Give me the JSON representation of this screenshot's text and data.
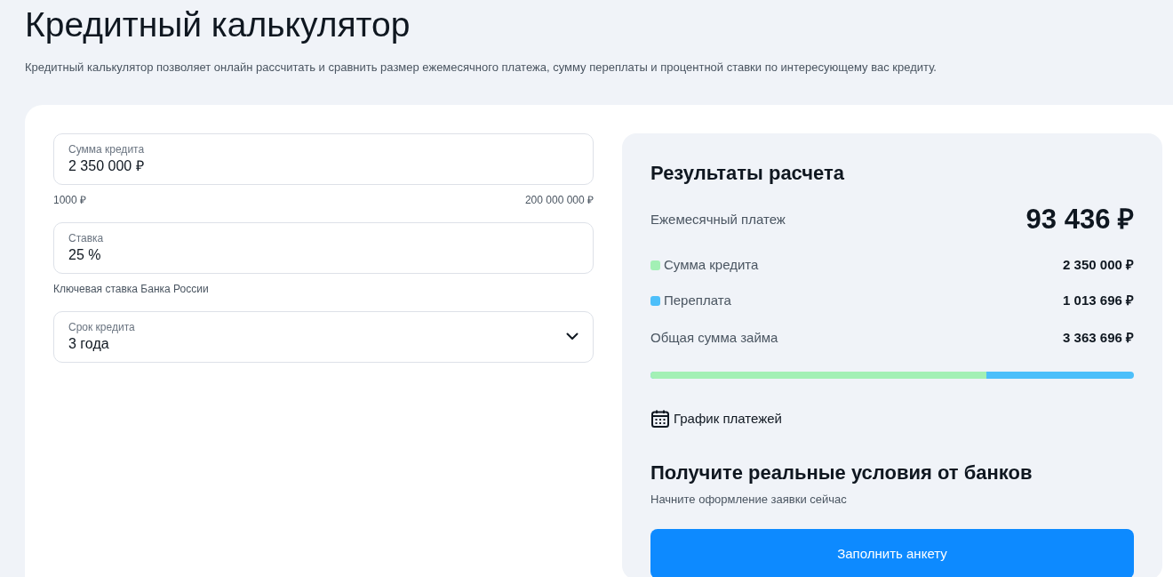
{
  "page": {
    "title": "Кредитный калькулятор",
    "description": "Кредитный калькулятор позволяет онлайн рассчитать и сравнить размер ежемесячного платежа, сумму переплаты и процентной ставки по интересующему вас кредиту."
  },
  "fields": [
    {
      "kind": "input",
      "label": "Сумма кредита",
      "value": "2 350 000 ₽",
      "min_label": "1000 ₽",
      "max_label": "200 000 000 ₽"
    },
    {
      "kind": "input",
      "label": "Ставка",
      "value": "25 %",
      "note": "Ключевая ставка Банка России"
    },
    {
      "kind": "select",
      "label": "Срок кредита",
      "value": "3 года"
    }
  ],
  "results": {
    "title": "Результаты расчета",
    "monthly": {
      "label": "Ежемесячный платеж",
      "value": "93 436 ₽"
    },
    "breakdown": [
      {
        "label": "Сумма кредита",
        "value": "2 350 000 ₽",
        "color": "#a3f0b5"
      },
      {
        "label": "Переплата",
        "value": "1 013 696 ₽",
        "color": "#4dbffa"
      }
    ],
    "total": {
      "label": "Общая сумма займа",
      "value": "3 363 696 ₽"
    },
    "progress": {
      "level": 0.695
    },
    "schedule_link": "График платежей",
    "offer_title": "Получите реальные условия от банков",
    "offer_subtitle": "Начните оформление заявки сейчас",
    "button": "Заполнить анкету"
  }
}
